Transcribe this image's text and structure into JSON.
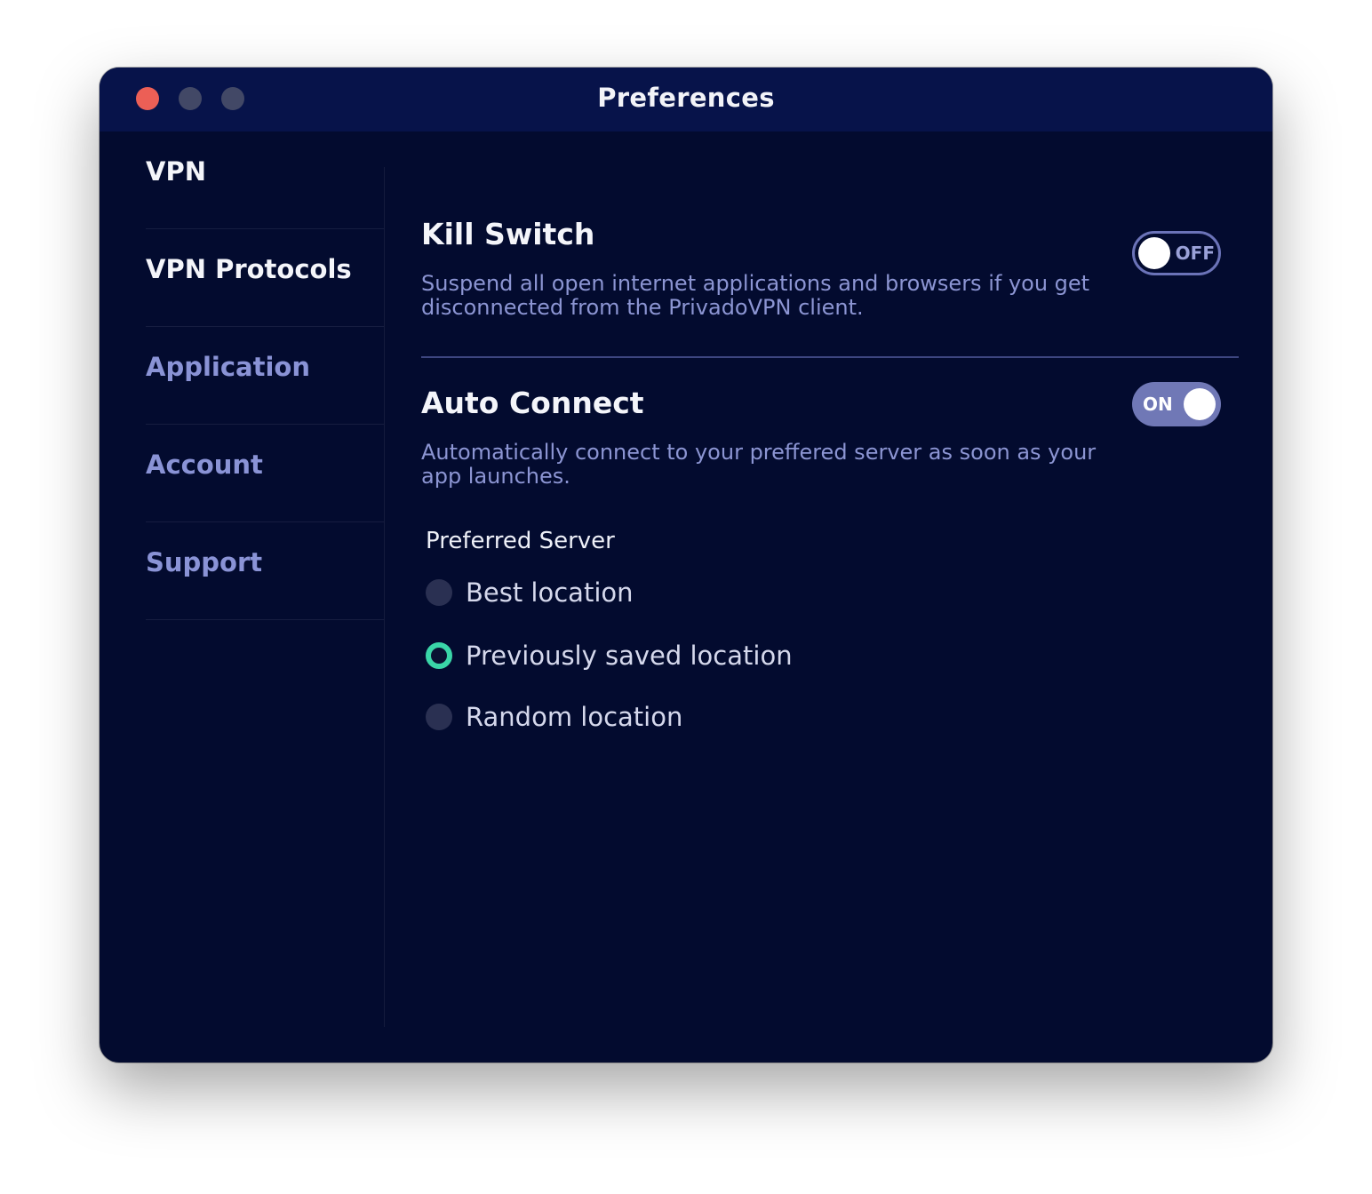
{
  "window": {
    "title": "Preferences"
  },
  "sidebar": {
    "items": [
      {
        "label": "VPN"
      },
      {
        "label": "VPN Protocols"
      },
      {
        "label": "Application"
      },
      {
        "label": "Account"
      },
      {
        "label": "Support"
      }
    ]
  },
  "kill_switch": {
    "title": "Kill Switch",
    "description": "Suspend all open internet applications and browsers if you get disconnected from the PrivadoVPN client.",
    "toggle_label": "OFF",
    "enabled": false
  },
  "auto_connect": {
    "title": "Auto Connect",
    "description": "Automatically connect to your preffered server as soon as your app launches.",
    "toggle_label": "ON",
    "enabled": true
  },
  "preferred_server": {
    "label": "Preferred Server",
    "options": [
      {
        "label": "Best location",
        "selected": false
      },
      {
        "label": "Previously saved location",
        "selected": true
      },
      {
        "label": "Random location",
        "selected": false
      }
    ]
  },
  "colors": {
    "window_bg": "#030b2f",
    "titlebar_bg": "#07134a",
    "accent_green": "#3ad6a8",
    "muted_text": "#8c95d3",
    "close_button": "#ec5f56"
  }
}
